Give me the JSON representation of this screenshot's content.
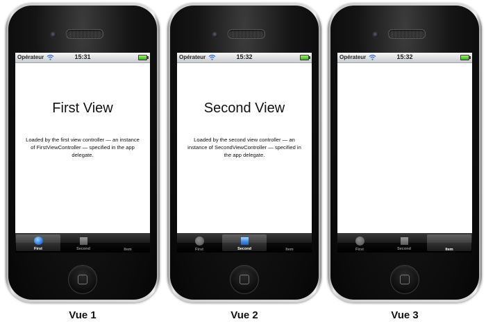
{
  "phones": [
    {
      "status": {
        "carrier": "Opérateur",
        "time": "15:31"
      },
      "view": {
        "title": "First View",
        "description": "Loaded by the first view controller — an instance of FirstViewController — specified in the app delegate."
      },
      "tabs": [
        {
          "label": "First",
          "icon": "circle-icon",
          "selected": true
        },
        {
          "label": "Second",
          "icon": "square-icon",
          "selected": false
        },
        {
          "label": "Item",
          "icon": "",
          "selected": false
        }
      ],
      "caption": "Vue 1"
    },
    {
      "status": {
        "carrier": "Opérateur",
        "time": "15:32"
      },
      "view": {
        "title": "Second View",
        "description": "Loaded by the second view controller — an instance of SecondViewController — specified in the app delegate."
      },
      "tabs": [
        {
          "label": "First",
          "icon": "circle-icon",
          "selected": false
        },
        {
          "label": "Second",
          "icon": "square-icon",
          "selected": true
        },
        {
          "label": "Item",
          "icon": "",
          "selected": false
        }
      ],
      "caption": "Vue 2"
    },
    {
      "status": {
        "carrier": "Opérateur",
        "time": "15:32"
      },
      "view": {
        "title": "",
        "description": ""
      },
      "tabs": [
        {
          "label": "First",
          "icon": "circle-icon",
          "selected": false
        },
        {
          "label": "Second",
          "icon": "square-icon",
          "selected": false
        },
        {
          "label": "Item",
          "icon": "",
          "selected": true
        }
      ],
      "caption": "Vue 3"
    }
  ],
  "colors": {
    "tab_selected_icon": "#2c7fe6",
    "battery_green": "#3bb018"
  }
}
